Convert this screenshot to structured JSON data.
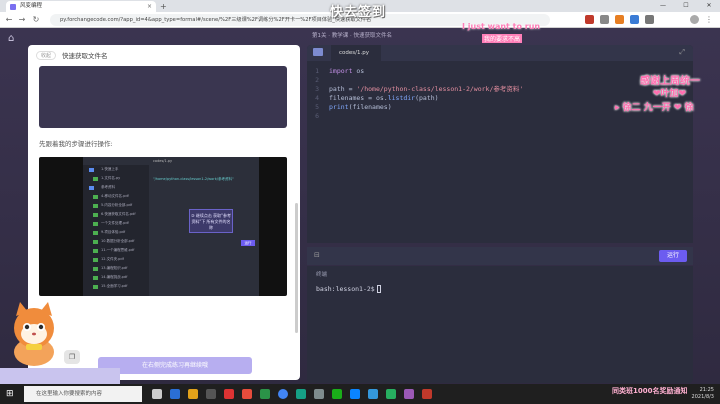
{
  "browser": {
    "tab_title": "风变编程",
    "tab_close": "×",
    "new_tab": "+",
    "url": "py.forchangecode.com/?app_id=4&app_type=formal#/scene/%2F三级课%2F调练分%2F开卡一%2F项目体验_快速获取文件名",
    "controls": {
      "minimize": "—",
      "maximize": "☐",
      "close": "✕"
    }
  },
  "page": {
    "breadcrumb": "第1关 · 教学课 · 快速获取文件名",
    "left_panel": {
      "collapse_label": "收起",
      "title": "快速获取文件名",
      "step_text": "先跟着我的步骤进行操作:",
      "next_button": "在右侧完成练习再继续哦",
      "video": {
        "title": "codes/1.py",
        "code_hint": "\"/home/python-class/lesson1-2/work/参考资料\"",
        "tree": [
          "1.快速上手",
          "1.文件名.py",
          "参考资料",
          "4-移动文件名.pdf",
          "5.内容分析全部.pdf",
          "6.快速获取文件名.pdf",
          "一个文件处理.pdf",
          "9.项目体验.pdf",
          "10.数据分析全部.pdf",
          "11.一个编程思维.pdf",
          "12.文件夹.pdf",
          "13.编程知识.pdf",
          "14.编程挑战.pdf",
          "15.全面学习.pdf"
        ],
        "tip": "③ 继续点击 获取\"参考资料\"下 所有文件的名称",
        "run": "运行"
      }
    },
    "editor": {
      "tab_label": "codes/1.py",
      "lines": [
        {
          "n": "1",
          "html": "<span class='kw'>import</span> os"
        },
        {
          "n": "2",
          "html": ""
        },
        {
          "n": "3",
          "html": "path = <span class='str'>'/home/python-class/lesson1-2/work/参考资料'</span>"
        },
        {
          "n": "4",
          "html": "filenames = os.<span class='fn'>listdir</span>(path)"
        },
        {
          "n": "5",
          "html": "<span class='fn'>print</span>(filenames)"
        },
        {
          "n": "6",
          "html": ""
        }
      ],
      "run_button": "运行"
    },
    "terminal": {
      "label": "终端",
      "prompt": "bash:lesson1-2$"
    }
  },
  "overlays": {
    "stream_title": "快去签到",
    "top_right_1": "I just want to run",
    "top_right_2": "我的要求不高",
    "right_1": "感谢上周统一",
    "right_2": "❤叶加❤",
    "right_3": "▸ 徐二 九一开 ❤ 徐",
    "bottom_right": "同类班1000名奖励通知"
  },
  "taskbar": {
    "search_placeholder": "在这里输入你要搜索的内容",
    "time": "21:25",
    "date": "2021/8/3"
  }
}
